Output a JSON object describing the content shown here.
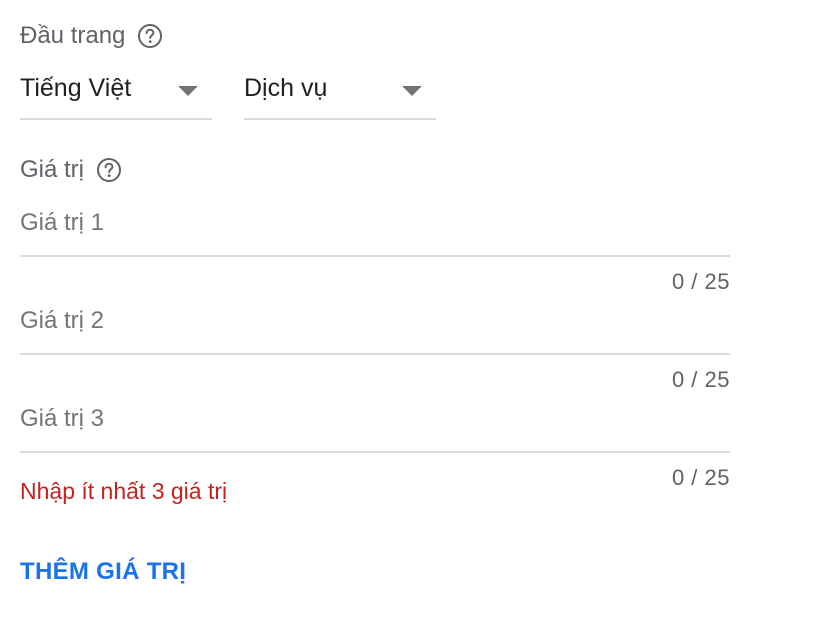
{
  "header_section": {
    "label": "Đầu trang",
    "help_icon": "help-circle-icon",
    "language_dropdown": {
      "value": "Tiếng Việt"
    },
    "header_type_dropdown": {
      "value": "Dịch vụ"
    }
  },
  "values_section": {
    "label": "Giá trị",
    "help_icon": "help-circle-icon",
    "fields": [
      {
        "placeholder": "Giá trị 1",
        "value": "",
        "counter": "0 / 25"
      },
      {
        "placeholder": "Giá trị 2",
        "value": "",
        "counter": "0 / 25"
      },
      {
        "placeholder": "Giá trị 3",
        "value": "",
        "counter": "0 / 25"
      }
    ],
    "error_message": "Nhập ít nhất 3 giá trị",
    "add_button_label": "THÊM GIÁ TRỊ"
  },
  "colors": {
    "accent": "#1a73e8",
    "error": "#c5221f",
    "divider": "#dadce0",
    "secondary_text": "#5f6368"
  }
}
